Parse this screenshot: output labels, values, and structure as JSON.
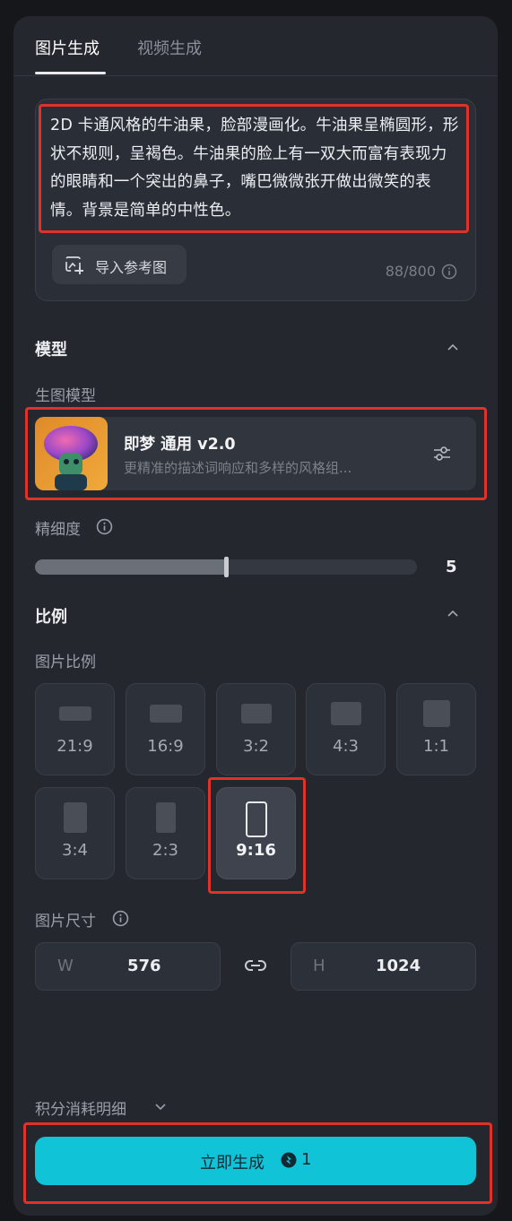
{
  "tabs": {
    "image": "图片生成",
    "video": "视频生成"
  },
  "prompt": {
    "text": "2D 卡通风格的牛油果，脸部漫画化。牛油果呈椭圆形，形状不规则，呈褐色。牛油果的脸上有一双大而富有表现力的眼睛和一个突出的鼻子，嘴巴微微张开做出微笑的表情。背景是简单的中性色。",
    "import_label": "导入参考图",
    "char_count": "88/800"
  },
  "model_section": {
    "title": "模型",
    "sub_label": "生图模型",
    "model_name": "即梦 通用 v2.0",
    "model_desc": "更精准的描述词响应和多样的风格组..."
  },
  "detail": {
    "label": "精细度",
    "value": "5",
    "level_fraction": 0.5
  },
  "ratio_section": {
    "title": "比例",
    "sub_label": "图片比例",
    "options": [
      "21:9",
      "16:9",
      "3:2",
      "4:3",
      "1:1",
      "3:4",
      "2:3",
      "9:16"
    ],
    "selected": "9:16"
  },
  "size": {
    "label": "图片尺寸",
    "w_prefix": "W",
    "w_value": "576",
    "h_prefix": "H",
    "h_value": "1024"
  },
  "credits": {
    "label": "积分消耗明细"
  },
  "generate": {
    "label": "立即生成",
    "cost": "1"
  },
  "colors": {
    "accent": "#10c3d6",
    "highlight_box": "#e0322b"
  }
}
